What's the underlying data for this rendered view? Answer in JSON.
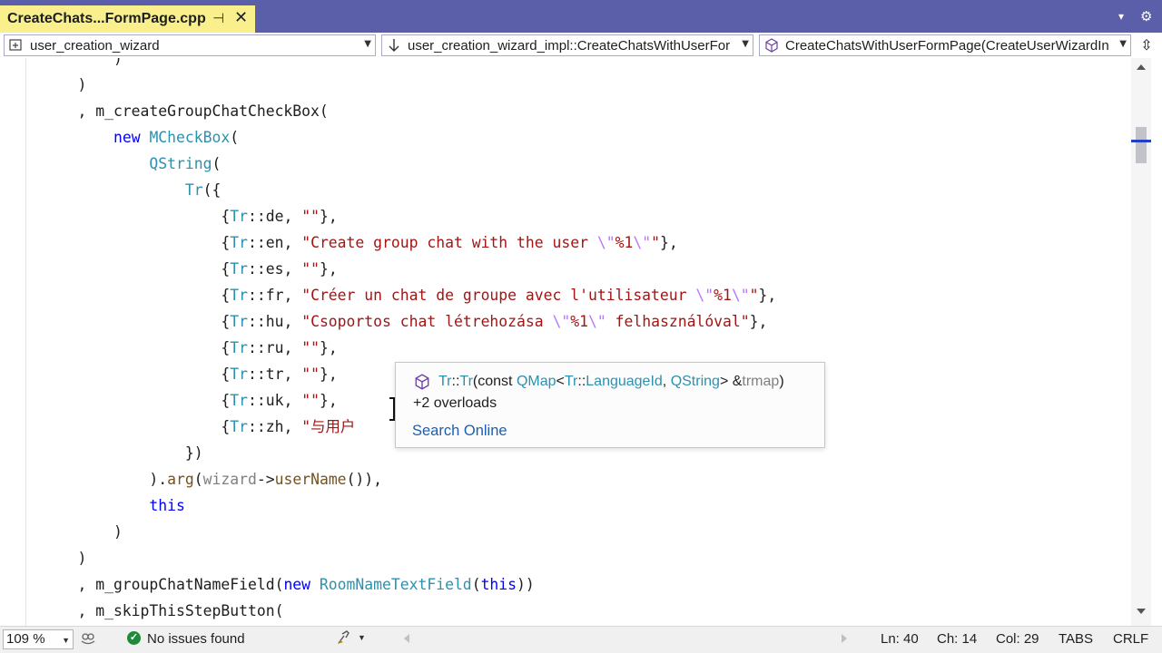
{
  "tab": {
    "title": "CreateChats...FormPage.cpp",
    "pin_glyph": "⊣",
    "close_glyph": "✕"
  },
  "tabbar": {
    "overflow_glyph": "▾",
    "settings_glyph": "⚙"
  },
  "navbar": {
    "project": "user_creation_wizard",
    "scope": "user_creation_wizard_impl::CreateChatsWithUserFor",
    "member": "CreateChatsWithUserFormPage(CreateUserWizardIn",
    "dropdown_glyph": "▼",
    "split_glyph": "⇳"
  },
  "code_lines": [
    [
      {
        "t": "        )",
        "c": "tx"
      }
    ],
    [
      {
        "t": "    )",
        "c": "tx"
      }
    ],
    [
      {
        "t": "    , m_createGroupChatCheckBox(",
        "c": "tx"
      }
    ],
    [
      {
        "t": "        ",
        "c": "tx"
      },
      {
        "t": "new",
        "c": "kw"
      },
      {
        "t": " ",
        "c": "tx"
      },
      {
        "t": "MCheckBox",
        "c": "ty"
      },
      {
        "t": "(",
        "c": "tx"
      }
    ],
    [
      {
        "t": "            ",
        "c": "tx"
      },
      {
        "t": "QString",
        "c": "ty"
      },
      {
        "t": "(",
        "c": "tx"
      }
    ],
    [
      {
        "t": "                ",
        "c": "tx"
      },
      {
        "t": "Tr",
        "c": "ty"
      },
      {
        "t": "({",
        "c": "tx"
      }
    ],
    [
      {
        "t": "                    {",
        "c": "tx"
      },
      {
        "t": "Tr",
        "c": "ty"
      },
      {
        "t": "::de, ",
        "c": "tx"
      },
      {
        "t": "\"\"",
        "c": "st"
      },
      {
        "t": "},",
        "c": "tx"
      }
    ],
    [
      {
        "t": "                    {",
        "c": "tx"
      },
      {
        "t": "Tr",
        "c": "ty"
      },
      {
        "t": "::en, ",
        "c": "tx"
      },
      {
        "t": "\"Create group chat with the user ",
        "c": "st"
      },
      {
        "t": "\\\"",
        "c": "es"
      },
      {
        "t": "%1",
        "c": "st"
      },
      {
        "t": "\\\"",
        "c": "es"
      },
      {
        "t": "\"",
        "c": "st"
      },
      {
        "t": "},",
        "c": "tx"
      }
    ],
    [
      {
        "t": "                    {",
        "c": "tx"
      },
      {
        "t": "Tr",
        "c": "ty"
      },
      {
        "t": "::es, ",
        "c": "tx"
      },
      {
        "t": "\"\"",
        "c": "st"
      },
      {
        "t": "},",
        "c": "tx"
      }
    ],
    [
      {
        "t": "                    {",
        "c": "tx"
      },
      {
        "t": "Tr",
        "c": "ty"
      },
      {
        "t": "::fr, ",
        "c": "tx"
      },
      {
        "t": "\"Créer un chat de groupe avec l'utilisateur ",
        "c": "st"
      },
      {
        "t": "\\\"",
        "c": "es"
      },
      {
        "t": "%1",
        "c": "st"
      },
      {
        "t": "\\\"",
        "c": "es"
      },
      {
        "t": "\"",
        "c": "st"
      },
      {
        "t": "},",
        "c": "tx"
      }
    ],
    [
      {
        "t": "                    {",
        "c": "tx"
      },
      {
        "t": "Tr",
        "c": "ty"
      },
      {
        "t": "::hu, ",
        "c": "tx"
      },
      {
        "t": "\"Csoportos chat létrehozása ",
        "c": "st"
      },
      {
        "t": "\\\"",
        "c": "es"
      },
      {
        "t": "%1",
        "c": "st"
      },
      {
        "t": "\\\"",
        "c": "es"
      },
      {
        "t": " felhasználóval\"",
        "c": "st"
      },
      {
        "t": "},",
        "c": "tx"
      }
    ],
    [
      {
        "t": "                    {",
        "c": "tx"
      },
      {
        "t": "Tr",
        "c": "ty"
      },
      {
        "t": "::ru, ",
        "c": "tx"
      },
      {
        "t": "\"\"",
        "c": "st"
      },
      {
        "t": "},",
        "c": "tx"
      }
    ],
    [
      {
        "t": "                    {",
        "c": "tx"
      },
      {
        "t": "Tr",
        "c": "ty"
      },
      {
        "t": "::tr, ",
        "c": "tx"
      },
      {
        "t": "\"\"",
        "c": "st"
      },
      {
        "t": "},",
        "c": "tx"
      }
    ],
    [
      {
        "t": "                    {",
        "c": "tx"
      },
      {
        "t": "Tr",
        "c": "ty"
      },
      {
        "t": "::uk, ",
        "c": "tx"
      },
      {
        "t": "\"\"",
        "c": "st"
      },
      {
        "t": "},",
        "c": "tx"
      }
    ],
    [
      {
        "t": "                    {",
        "c": "tx"
      },
      {
        "t": "Tr",
        "c": "ty"
      },
      {
        "t": "::zh, ",
        "c": "tx"
      },
      {
        "t": "\"与用户",
        "c": "st"
      }
    ],
    [
      {
        "t": "                })",
        "c": "tx"
      }
    ],
    [
      {
        "t": "            ).",
        "c": "tx"
      },
      {
        "t": "arg",
        "c": "fn"
      },
      {
        "t": "(",
        "c": "tx"
      },
      {
        "t": "wizard",
        "c": "pm"
      },
      {
        "t": "->",
        "c": "tx"
      },
      {
        "t": "userName",
        "c": "fn"
      },
      {
        "t": "()),",
        "c": "tx"
      }
    ],
    [
      {
        "t": "            ",
        "c": "tx"
      },
      {
        "t": "this",
        "c": "kw"
      }
    ],
    [
      {
        "t": "        )",
        "c": "tx"
      }
    ],
    [
      {
        "t": "    )",
        "c": "tx"
      }
    ],
    [
      {
        "t": "    , m_groupChatNameField(",
        "c": "tx"
      },
      {
        "t": "new",
        "c": "kw"
      },
      {
        "t": " ",
        "c": "tx"
      },
      {
        "t": "RoomNameTextField",
        "c": "ty"
      },
      {
        "t": "(",
        "c": "tx"
      },
      {
        "t": "this",
        "c": "kw"
      },
      {
        "t": "))",
        "c": "tx"
      }
    ],
    [
      {
        "t": "    , m_skipThisStepButton(",
        "c": "tx"
      }
    ]
  ],
  "quick_info": {
    "signature": [
      {
        "t": "Tr",
        "c": "g"
      },
      {
        "t": "::",
        "c": "d"
      },
      {
        "t": "Tr",
        "c": "g"
      },
      {
        "t": "(const ",
        "c": "d"
      },
      {
        "t": "QMap",
        "c": "g"
      },
      {
        "t": "<",
        "c": "d"
      },
      {
        "t": "Tr",
        "c": "g"
      },
      {
        "t": "::",
        "c": "d"
      },
      {
        "t": "LanguageId",
        "c": "g"
      },
      {
        "t": ", ",
        "c": "d"
      },
      {
        "t": "QString",
        "c": "g"
      },
      {
        "t": "> &",
        "c": "d"
      },
      {
        "t": "trmap",
        "c": "p"
      },
      {
        "t": ")",
        "c": "d"
      }
    ],
    "overloads": "+2 overloads",
    "search_online": "Search Online"
  },
  "status": {
    "zoom": "109 %",
    "issues": "No issues found",
    "issues_glyph": "✓",
    "line": "Ln: 40",
    "char": "Ch: 14",
    "col": "Col: 29",
    "indent": "TABS",
    "eol": "CRLF"
  },
  "colors": {
    "tabbar": "#5b5ea8",
    "active_tab": "#f9f08d",
    "keyword": "#0000ff",
    "type": "#2b91af",
    "string": "#a31515",
    "escape": "#b776fb",
    "issues_ok": "#1f8a3a"
  }
}
